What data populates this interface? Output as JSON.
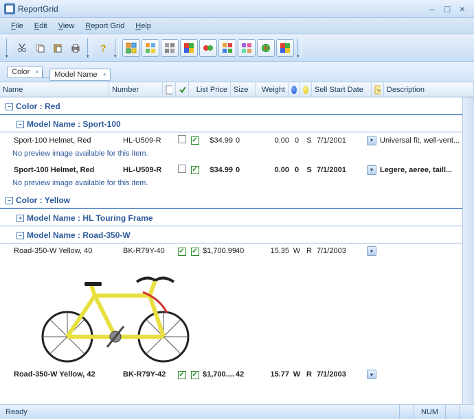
{
  "window": {
    "title": "ReportGrid"
  },
  "menu": {
    "file": "File",
    "edit": "Edit",
    "view": "View",
    "reportgrid": "Report Grid",
    "help": "Help"
  },
  "groupby": {
    "first": "Color",
    "second": "Model Name"
  },
  "columns": {
    "name": "Name",
    "number": "Number",
    "listprice": "List Price",
    "size": "Size",
    "weight": "Weight",
    "sellstart": "Sell Start Date",
    "description": "Description"
  },
  "groups": {
    "color_red": "Color : Red",
    "color_yellow": "Color : Yellow",
    "model_sport100": "Model Name : Sport-100",
    "model_hltouring": "Model Name : HL Touring Frame",
    "model_road350w": "Model Name : Road-350-W"
  },
  "rows": {
    "r1": {
      "name": "Sport-100 Helmet, Red",
      "number": "HL-U509-R",
      "price": "$34.99",
      "size": "0",
      "weight": "0.00",
      "wu": "0",
      "ru": "S",
      "date": "7/1/2001",
      "desc": "Universal fit, well-vent..."
    },
    "r2": {
      "name": "Sport-100 Helmet, Red",
      "number": "HL-U509-R",
      "price": "$34.99",
      "size": "0",
      "weight": "0.00",
      "wu": "0",
      "ru": "S",
      "date": "7/1/2001",
      "desc": "Legere, aeree, taill..."
    },
    "r3": {
      "name": "Road-350-W Yellow, 40",
      "number": "BK-R79Y-40",
      "price": "$1,700.99",
      "size": "40",
      "weight": "15.35",
      "wu": "W",
      "ru": "R",
      "date": "7/1/2003",
      "desc": ""
    },
    "r4": {
      "name": "Road-350-W Yellow, 42",
      "number": "BK-R79Y-42",
      "price": "$1,700....",
      "size": "42",
      "weight": "15.77",
      "wu": "W",
      "ru": "R",
      "date": "7/1/2003",
      "desc": ""
    }
  },
  "nopreview": "No preview image available for this item.",
  "status": {
    "ready": "Ready",
    "num": "NUM"
  }
}
